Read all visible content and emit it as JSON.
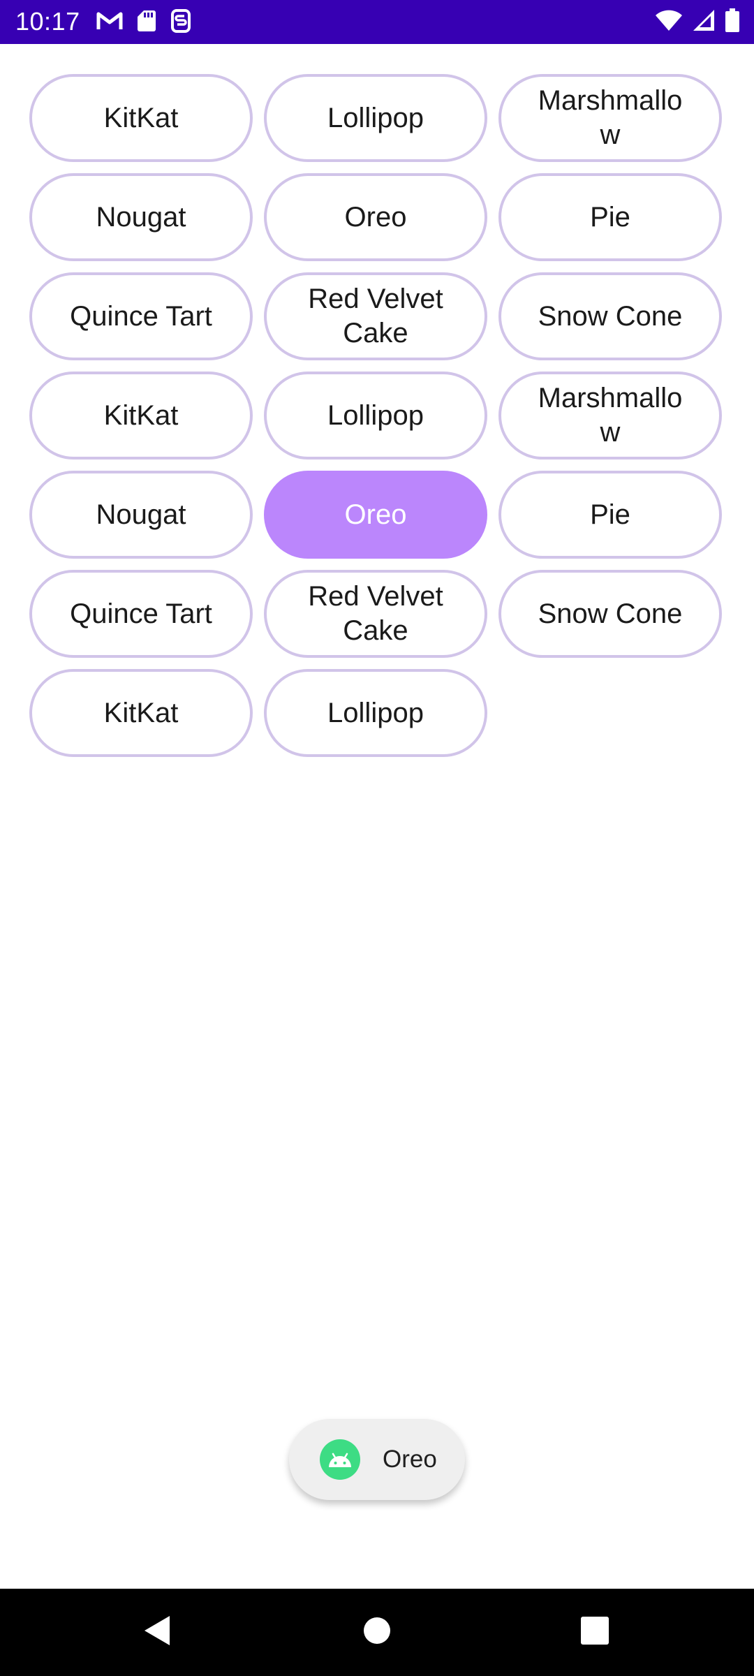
{
  "status_bar": {
    "time": "10:17",
    "background": "#3700b3",
    "left_icons": [
      "gmail-icon",
      "sd-card-icon",
      "sync-icon"
    ],
    "right_icons": [
      "wifi-icon",
      "cellular-signal-icon",
      "battery-icon"
    ]
  },
  "chips": [
    {
      "label": "KitKat",
      "selected": false
    },
    {
      "label": "Lollipop",
      "selected": false
    },
    {
      "label": "Marshmallow",
      "selected": false
    },
    {
      "label": "Nougat",
      "selected": false
    },
    {
      "label": "Oreo",
      "selected": false
    },
    {
      "label": "Pie",
      "selected": false
    },
    {
      "label": "Quince Tart",
      "selected": false
    },
    {
      "label": "Red Velvet Cake",
      "selected": false
    },
    {
      "label": "Snow Cone",
      "selected": false
    },
    {
      "label": "KitKat",
      "selected": false
    },
    {
      "label": "Lollipop",
      "selected": false
    },
    {
      "label": "Marshmallow",
      "selected": false
    },
    {
      "label": "Nougat",
      "selected": false
    },
    {
      "label": "Oreo",
      "selected": true
    },
    {
      "label": "Pie",
      "selected": false
    },
    {
      "label": "Quince Tart",
      "selected": false
    },
    {
      "label": "Red Velvet Cake",
      "selected": false
    },
    {
      "label": "Snow Cone",
      "selected": false
    },
    {
      "label": "KitKat",
      "selected": false
    },
    {
      "label": "Lollipop",
      "selected": false
    }
  ],
  "colors": {
    "chip_border": "#d1c4e9",
    "chip_selected": "#bb86fc"
  },
  "toast": {
    "text": "Oreo",
    "icon": "android-icon"
  },
  "nav_bar": {
    "buttons": [
      "back-icon",
      "home-icon",
      "recents-icon"
    ]
  }
}
